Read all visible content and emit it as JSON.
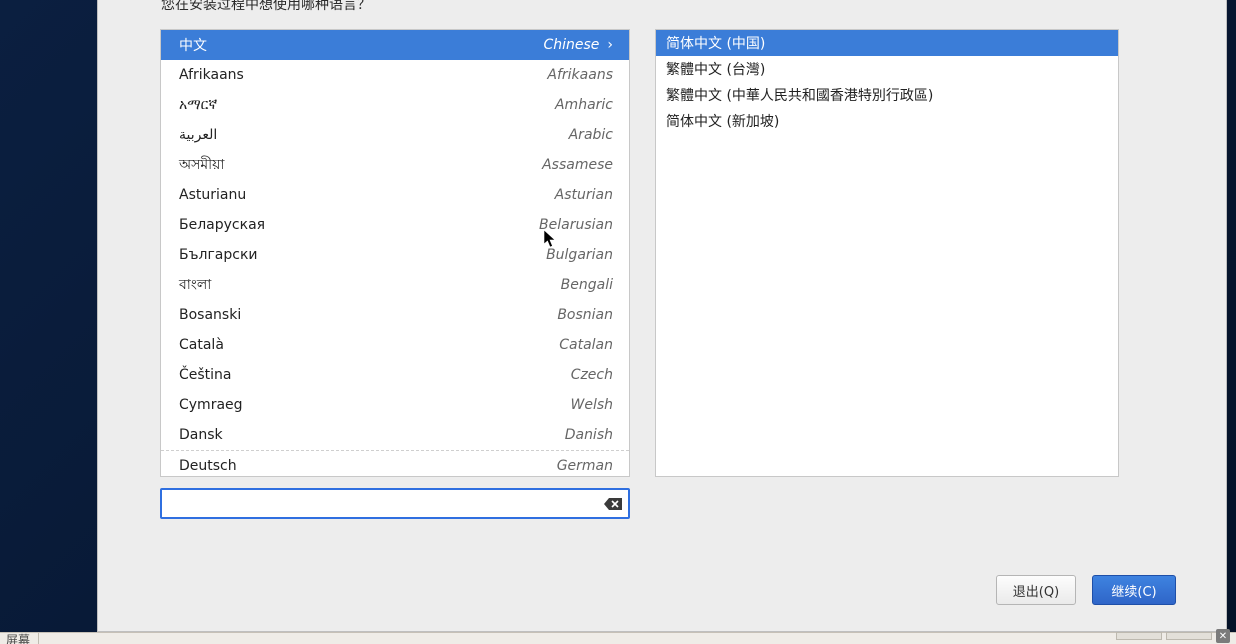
{
  "prompt": "您在安装过程中想使用哪种语言？",
  "languages": [
    {
      "native": "中文",
      "english": "Chinese",
      "selected": true
    },
    {
      "native": "Afrikaans",
      "english": "Afrikaans",
      "selected": false
    },
    {
      "native": "አማርኛ",
      "english": "Amharic",
      "selected": false
    },
    {
      "native": "العربية",
      "english": "Arabic",
      "selected": false
    },
    {
      "native": "অসমীয়া",
      "english": "Assamese",
      "selected": false
    },
    {
      "native": "Asturianu",
      "english": "Asturian",
      "selected": false
    },
    {
      "native": "Беларуская",
      "english": "Belarusian",
      "selected": false
    },
    {
      "native": "Български",
      "english": "Bulgarian",
      "selected": false
    },
    {
      "native": "বাংলা",
      "english": "Bengali",
      "selected": false
    },
    {
      "native": "Bosanski",
      "english": "Bosnian",
      "selected": false
    },
    {
      "native": "Català",
      "english": "Catalan",
      "selected": false
    },
    {
      "native": "Čeština",
      "english": "Czech",
      "selected": false
    },
    {
      "native": "Cymraeg",
      "english": "Welsh",
      "selected": false
    },
    {
      "native": "Dansk",
      "english": "Danish",
      "selected": false
    },
    {
      "native": "Deutsch",
      "english": "German",
      "selected": false
    }
  ],
  "variants": [
    {
      "label": "简体中文 (中国)",
      "selected": true
    },
    {
      "label": "繁體中文 (台灣)",
      "selected": false
    },
    {
      "label": "繁體中文 (中華人民共和國香港特別行政區)",
      "selected": false
    },
    {
      "label": "简体中文 (新加坡)",
      "selected": false
    }
  ],
  "search": {
    "value": "",
    "placeholder": ""
  },
  "buttons": {
    "quit": "退出(Q)",
    "continue": "继续(C)"
  },
  "taskbar": {
    "label": "屏幕"
  }
}
